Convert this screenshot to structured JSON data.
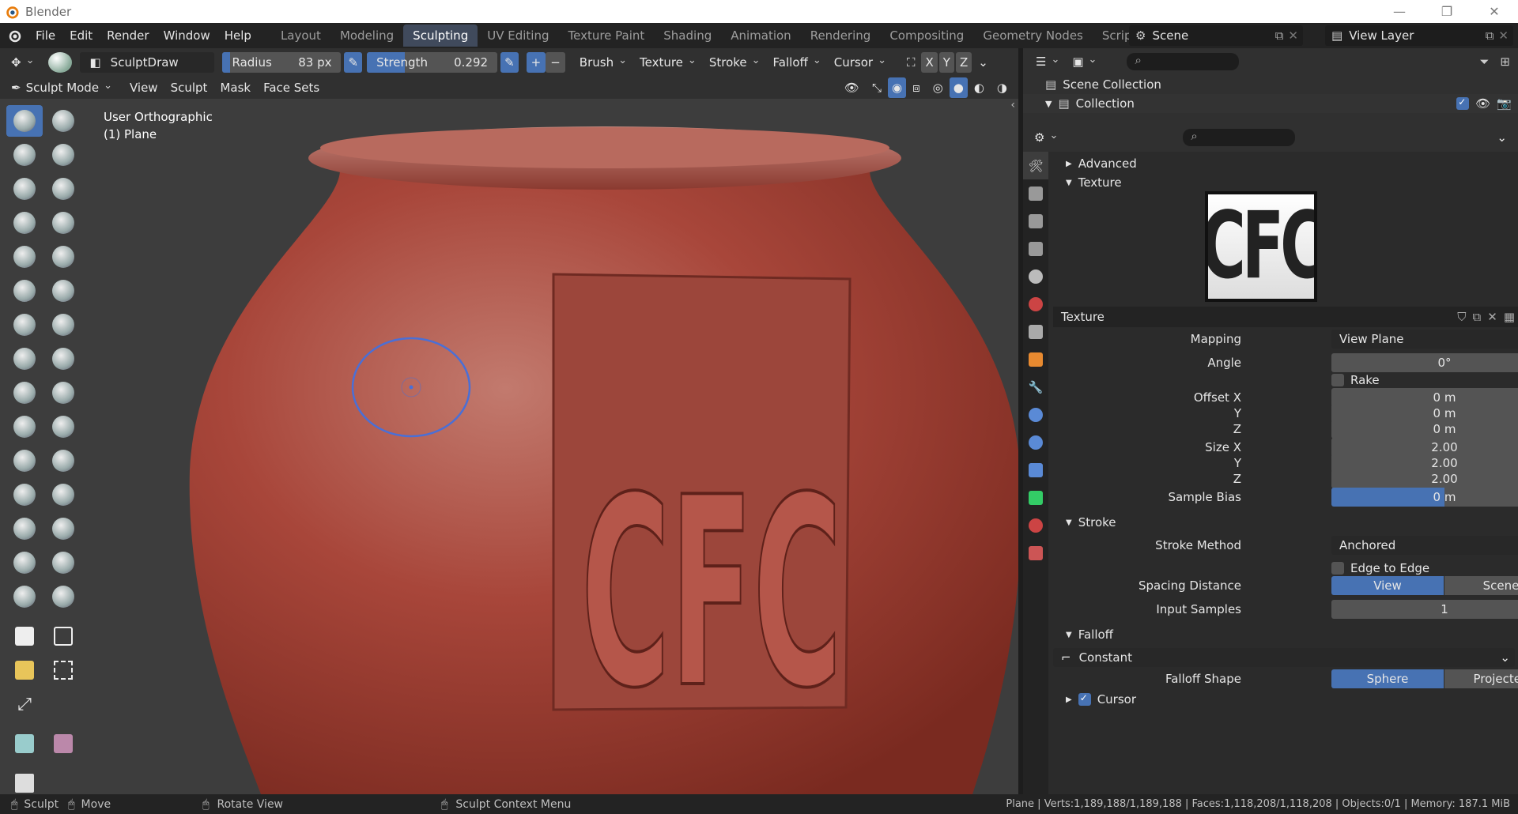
{
  "window": {
    "title": "Blender"
  },
  "menu": [
    "File",
    "Edit",
    "Render",
    "Window",
    "Help"
  ],
  "workspaces": [
    "Layout",
    "Modeling",
    "Sculpting",
    "UV Editing",
    "Texture Paint",
    "Shading",
    "Animation",
    "Rendering",
    "Compositing",
    "Geometry Nodes",
    "Scripting"
  ],
  "active_workspace": "Sculpting",
  "scene": {
    "name": "Scene",
    "view_layer": "View Layer"
  },
  "tool_header": {
    "brush_name": "SculptDraw",
    "radius_label": "Radius",
    "radius_value": "83 px",
    "strength_label": "Strength",
    "strength_value": "0.292",
    "menus": [
      "Brush",
      "Texture",
      "Stroke",
      "Falloff",
      "Cursor"
    ],
    "axes": [
      "X",
      "Y",
      "Z"
    ]
  },
  "mode_header": {
    "mode": "Sculpt Mode",
    "menus": [
      "View",
      "Sculpt",
      "Mask",
      "Face Sets"
    ]
  },
  "viewport": {
    "overlay_view": "User Orthographic",
    "overlay_object": "(1) Plane"
  },
  "outliner": {
    "scene_collection": "Scene Collection",
    "collection": "Collection"
  },
  "properties": {
    "advanced": "Advanced",
    "texture_section": "Texture",
    "texture_preview_text": "CFC",
    "texture_name": "Texture",
    "mapping": {
      "label": "Mapping",
      "value": "View Plane"
    },
    "angle": {
      "label": "Angle",
      "value": "0°"
    },
    "rake": "Rake",
    "offset": {
      "x_label": "Offset X",
      "x": "0 m",
      "y_label": "Y",
      "y": "0 m",
      "z_label": "Z",
      "z": "0 m"
    },
    "size": {
      "x_label": "Size X",
      "x": "2.00",
      "y_label": "Y",
      "y": "2.00",
      "z_label": "Z",
      "z": "2.00"
    },
    "sample_bias": {
      "label": "Sample Bias",
      "value": "0 m"
    },
    "stroke_section": "Stroke",
    "stroke_method": {
      "label": "Stroke Method",
      "value": "Anchored"
    },
    "edge_to_edge": "Edge to Edge",
    "spacing_distance": {
      "label": "Spacing Distance",
      "options": [
        "View",
        "Scene"
      ]
    },
    "input_samples": {
      "label": "Input Samples",
      "value": "1"
    },
    "falloff_section": "Falloff",
    "falloff_preset": "Constant",
    "falloff_shape": {
      "label": "Falloff Shape",
      "options": [
        "Sphere",
        "Projected"
      ]
    },
    "cursor_section": "Cursor"
  },
  "status_bar": {
    "sculpt": "Sculpt",
    "move": "Move",
    "rotate": "Rotate View",
    "context": "Sculpt Context Menu",
    "stats": "Plane | Verts:1,189,188/1,189,188 | Faces:1,118,208/1,118,208 | Objects:0/1 | Memory: 187.1 MiB"
  },
  "colors": {
    "accent": "#4772b3",
    "pot": "#a8463a"
  }
}
